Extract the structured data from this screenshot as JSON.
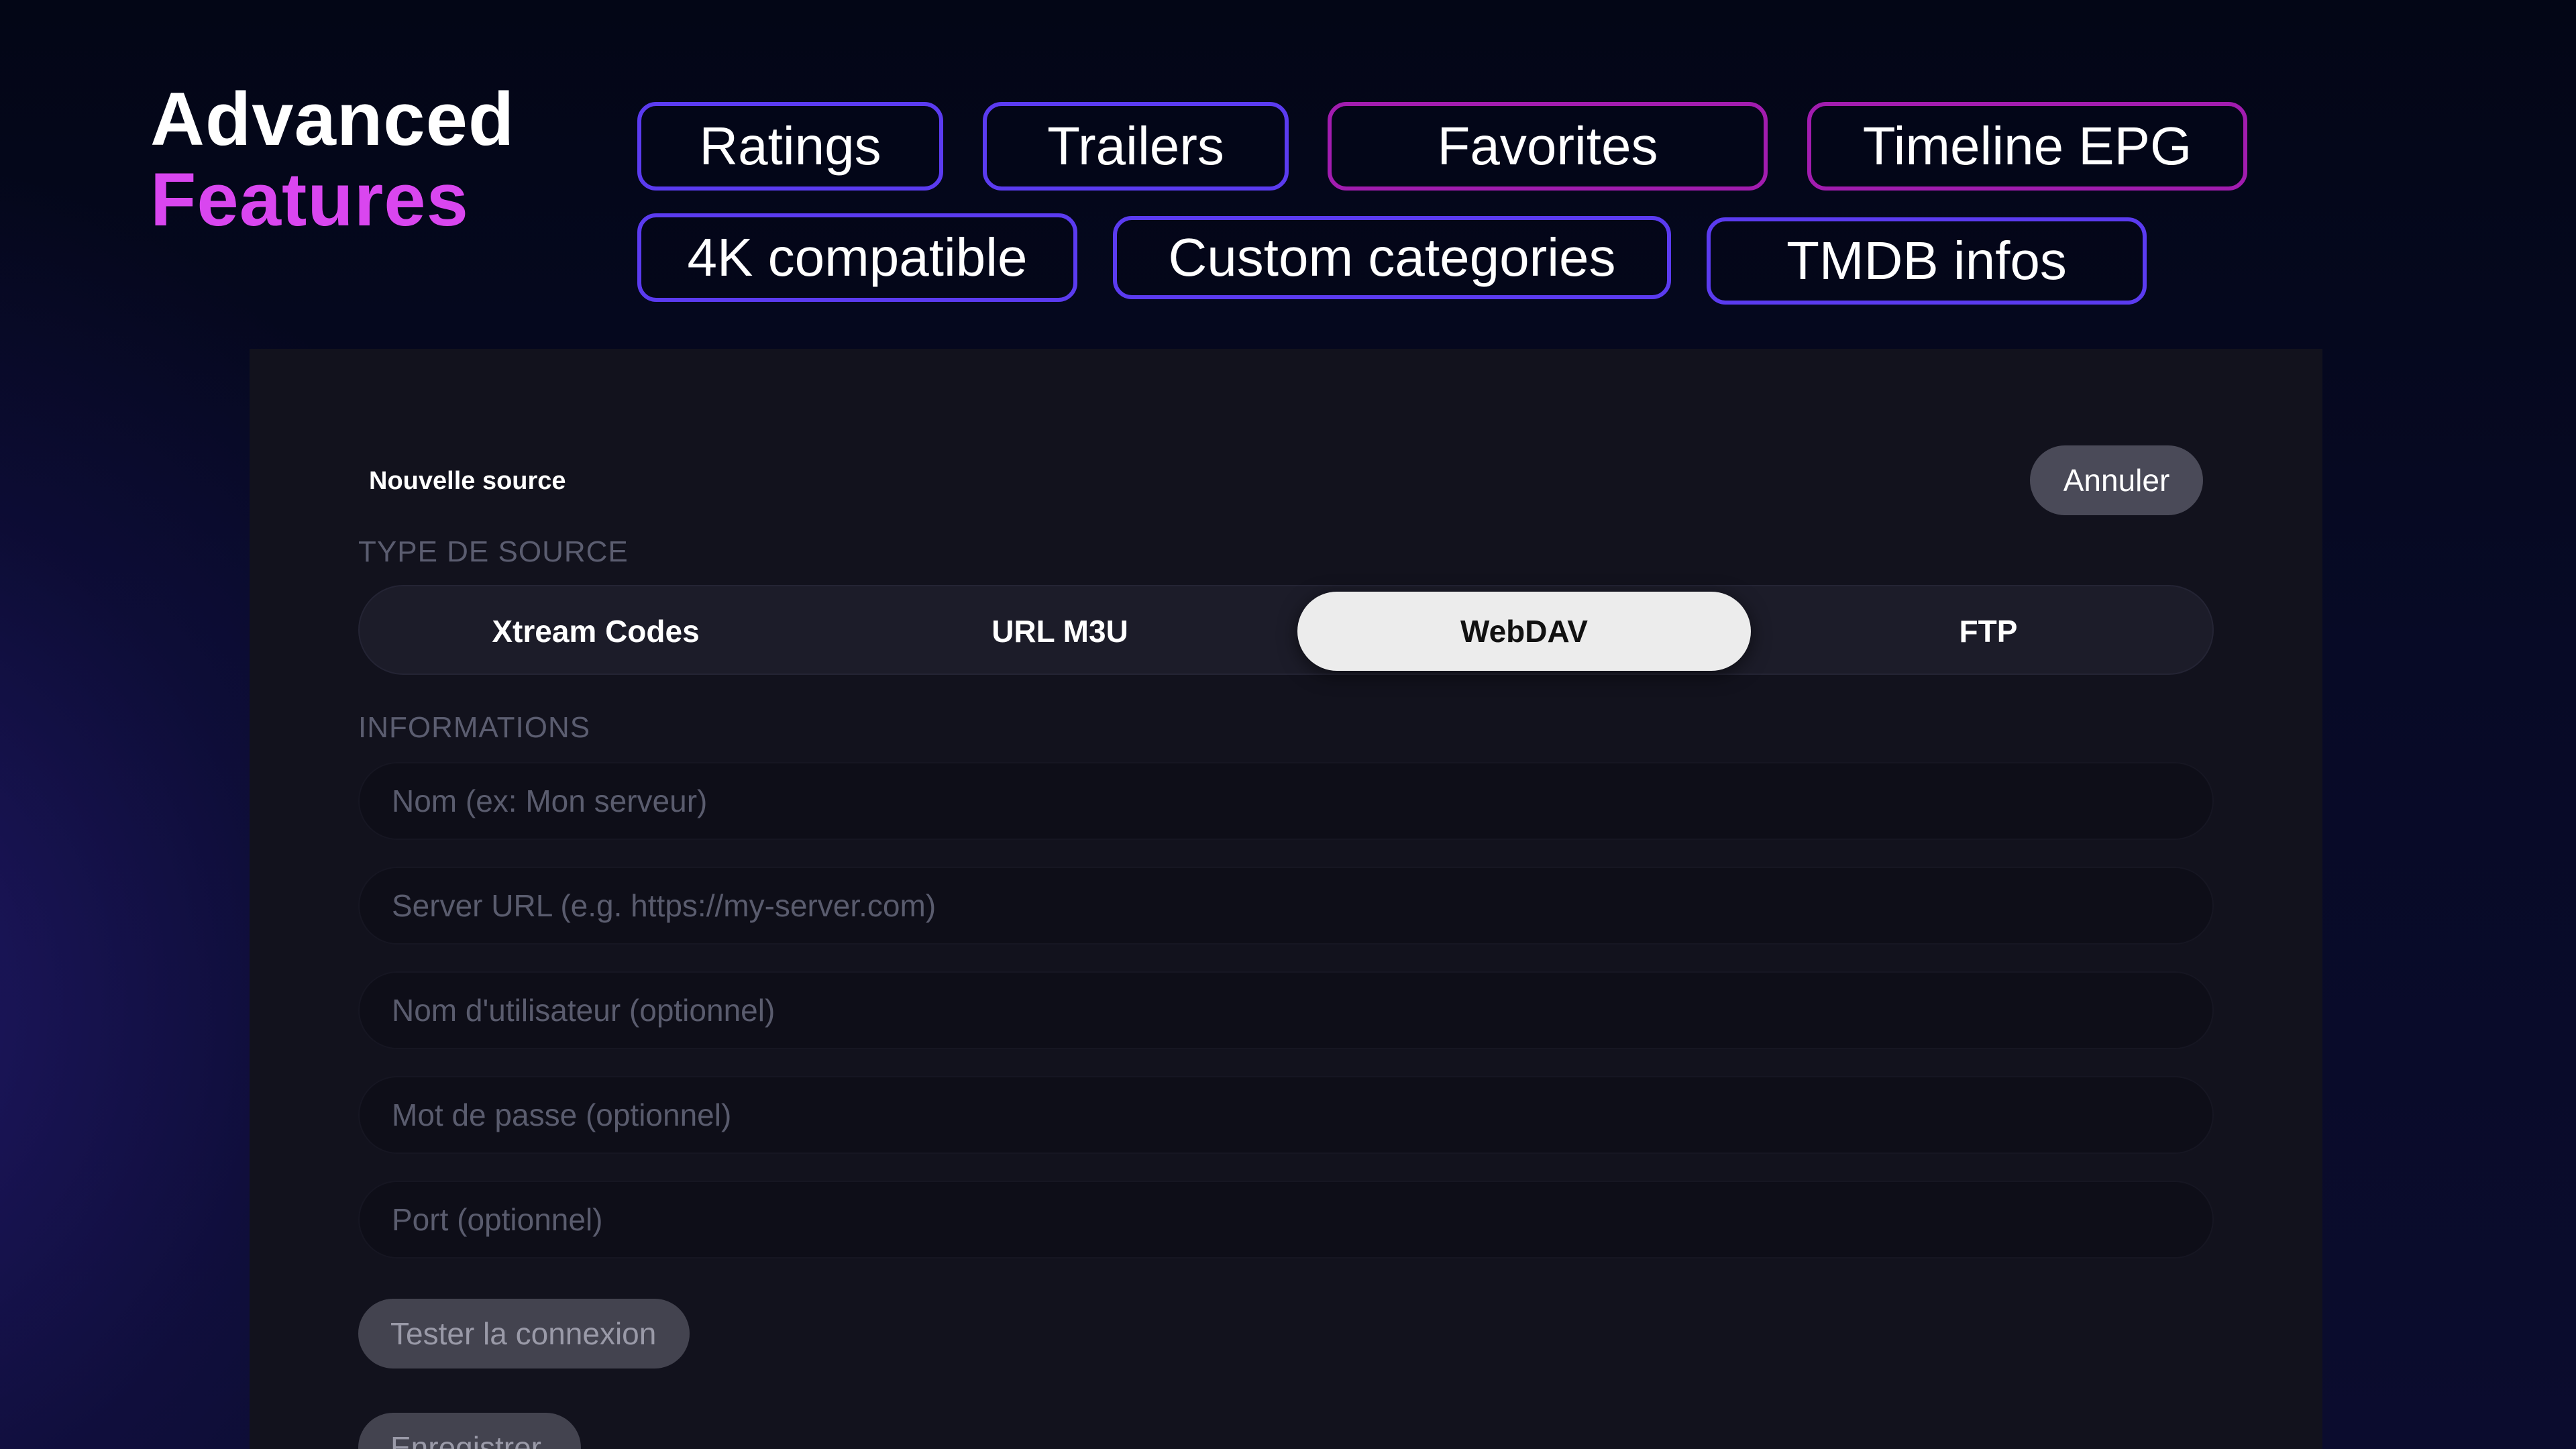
{
  "hero": {
    "title_line1": "Advanced",
    "title_line2": "Features"
  },
  "feature_chips": [
    {
      "label": "Ratings",
      "border": "#5b3bf0"
    },
    {
      "label": "Trailers",
      "border": "#5b3bf0"
    },
    {
      "label": "Favorites",
      "border": "#a21caf"
    },
    {
      "label": "Timeline EPG",
      "border": "#a21caf"
    },
    {
      "label": "4K compatible",
      "border": "#5b3bf0"
    },
    {
      "label": "Custom categories",
      "border": "#5b3bf0"
    },
    {
      "label": "TMDB infos",
      "border": "#5b3bf0"
    }
  ],
  "form": {
    "title": "Nouvelle source",
    "cancel_label": "Annuler",
    "source_type_label": "TYPE DE SOURCE",
    "source_types": [
      {
        "label": "Xtream Codes",
        "selected": false
      },
      {
        "label": "URL M3U",
        "selected": false
      },
      {
        "label": "WebDAV",
        "selected": true
      },
      {
        "label": "FTP",
        "selected": false
      }
    ],
    "info_label": "INFORMATIONS",
    "fields": [
      {
        "placeholder": "Nom (ex: Mon serveur)",
        "value": ""
      },
      {
        "placeholder": "Server URL (e.g. https://my-server.com)",
        "value": ""
      },
      {
        "placeholder": "Nom d'utilisateur (optionnel)",
        "value": ""
      },
      {
        "placeholder": "Mot de passe (optionnel)",
        "value": ""
      },
      {
        "placeholder": "Port (optionnel)",
        "value": ""
      }
    ],
    "test_label": "Tester la connexion",
    "save_label": "Enregistrer"
  },
  "colors": {
    "accent_pink": "#d946ef",
    "chip_indigo": "#5b3bf0",
    "chip_magenta": "#a21caf",
    "panel_bg": "#12121d",
    "selected_segment_bg": "#ececec"
  }
}
